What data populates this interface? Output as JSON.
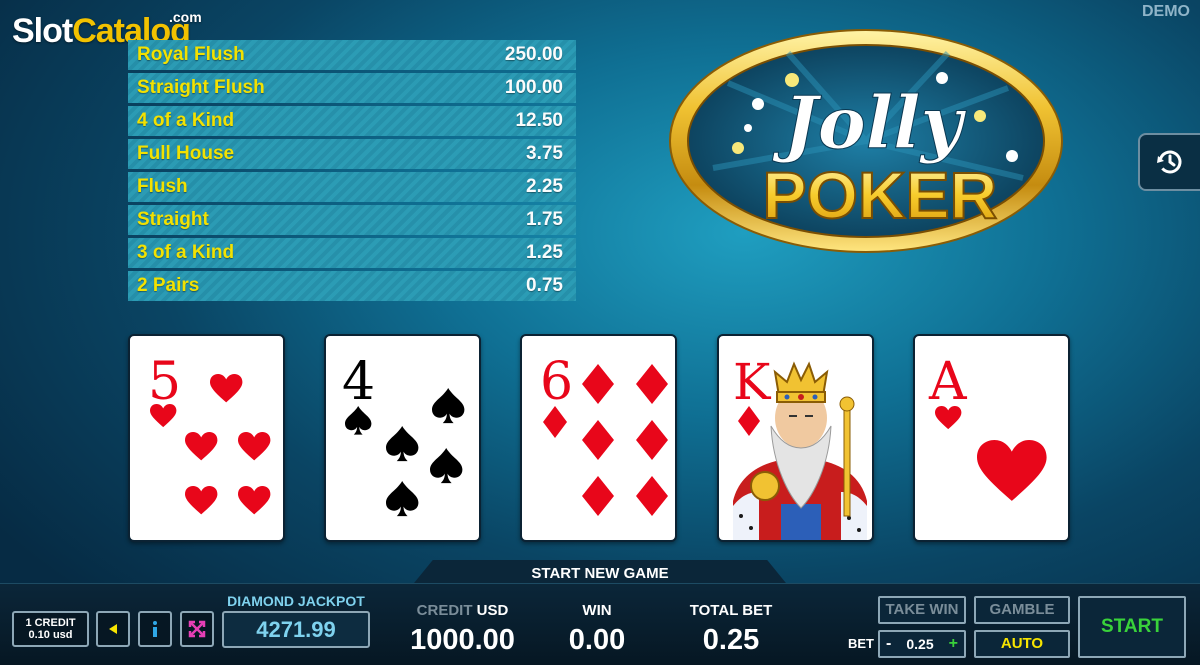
{
  "watermark": {
    "part1": "Slot",
    "part2": "Catalog",
    "suffix": ".com"
  },
  "demo_label": "DEMO",
  "logo": {
    "line1": "Jolly",
    "line2": "POKER"
  },
  "paytable": [
    {
      "hand": "Royal Flush",
      "payout": "250.00"
    },
    {
      "hand": "Straight Flush",
      "payout": "100.00"
    },
    {
      "hand": "4 of a Kind",
      "payout": "12.50"
    },
    {
      "hand": "Full House",
      "payout": "3.75"
    },
    {
      "hand": "Flush",
      "payout": "2.25"
    },
    {
      "hand": "Straight",
      "payout": "1.75"
    },
    {
      "hand": "3 of a Kind",
      "payout": "1.25"
    },
    {
      "hand": "2 Pairs",
      "payout": "0.75"
    }
  ],
  "cards": [
    {
      "rank": "5",
      "suit": "hearts"
    },
    {
      "rank": "4",
      "suit": "spades"
    },
    {
      "rank": "6",
      "suit": "diamonds"
    },
    {
      "rank": "K",
      "suit": "diamonds"
    },
    {
      "rank": "A",
      "suit": "hearts"
    }
  ],
  "colors": {
    "red_suit": "#e8061a",
    "black_suit": "#000000",
    "paytable_text": "#f7e500",
    "start": "#39d23a",
    "jackpot": "#7fd2ee"
  },
  "status": "START NEW GAME",
  "controls": {
    "credit_denom_line1": "1 CREDIT",
    "credit_denom_line2": "0.10 usd",
    "sound_icon": "speaker-icon",
    "info_icon": "info-icon",
    "fullscreen_icon": "fullscreen-icon"
  },
  "jackpot": {
    "label": "DIAMOND JACKPOT",
    "value": "4271.99"
  },
  "meters": {
    "credit_label": "CREDIT",
    "credit_currency": "USD",
    "credit_value": "1000.00",
    "win_label": "WIN",
    "win_value": "0.00",
    "total_bet_label": "TOTAL BET",
    "total_bet_value": "0.25"
  },
  "buttons": {
    "take_win": "TAKE WIN",
    "gamble": "GAMBLE",
    "auto": "AUTO",
    "start": "START",
    "bet_label": "BET",
    "bet_minus": "-",
    "bet_value": "0.25",
    "bet_plus": "+"
  }
}
